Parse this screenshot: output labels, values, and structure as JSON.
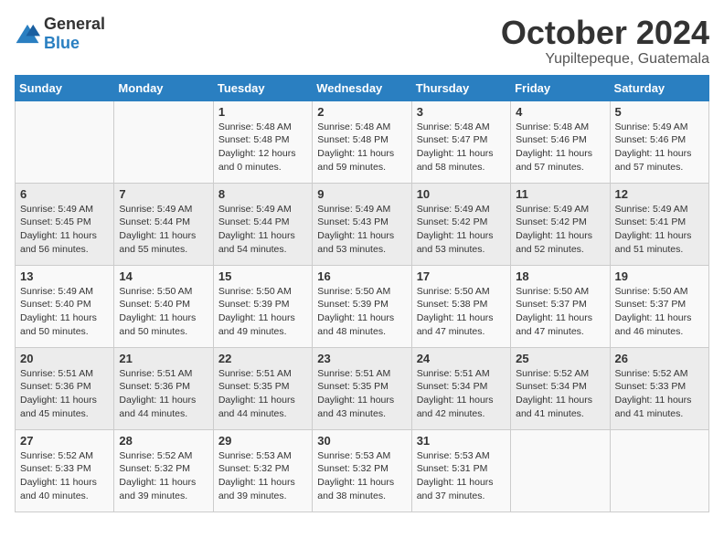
{
  "logo": {
    "general": "General",
    "blue": "Blue"
  },
  "title": "October 2024",
  "subtitle": "Yupiltepeque, Guatemala",
  "headers": [
    "Sunday",
    "Monday",
    "Tuesday",
    "Wednesday",
    "Thursday",
    "Friday",
    "Saturday"
  ],
  "weeks": [
    [
      {
        "day": "",
        "info": ""
      },
      {
        "day": "",
        "info": ""
      },
      {
        "day": "1",
        "info": "Sunrise: 5:48 AM\nSunset: 5:48 PM\nDaylight: 12 hours\nand 0 minutes."
      },
      {
        "day": "2",
        "info": "Sunrise: 5:48 AM\nSunset: 5:48 PM\nDaylight: 11 hours\nand 59 minutes."
      },
      {
        "day": "3",
        "info": "Sunrise: 5:48 AM\nSunset: 5:47 PM\nDaylight: 11 hours\nand 58 minutes."
      },
      {
        "day": "4",
        "info": "Sunrise: 5:48 AM\nSunset: 5:46 PM\nDaylight: 11 hours\nand 57 minutes."
      },
      {
        "day": "5",
        "info": "Sunrise: 5:49 AM\nSunset: 5:46 PM\nDaylight: 11 hours\nand 57 minutes."
      }
    ],
    [
      {
        "day": "6",
        "info": "Sunrise: 5:49 AM\nSunset: 5:45 PM\nDaylight: 11 hours\nand 56 minutes."
      },
      {
        "day": "7",
        "info": "Sunrise: 5:49 AM\nSunset: 5:44 PM\nDaylight: 11 hours\nand 55 minutes."
      },
      {
        "day": "8",
        "info": "Sunrise: 5:49 AM\nSunset: 5:44 PM\nDaylight: 11 hours\nand 54 minutes."
      },
      {
        "day": "9",
        "info": "Sunrise: 5:49 AM\nSunset: 5:43 PM\nDaylight: 11 hours\nand 53 minutes."
      },
      {
        "day": "10",
        "info": "Sunrise: 5:49 AM\nSunset: 5:42 PM\nDaylight: 11 hours\nand 53 minutes."
      },
      {
        "day": "11",
        "info": "Sunrise: 5:49 AM\nSunset: 5:42 PM\nDaylight: 11 hours\nand 52 minutes."
      },
      {
        "day": "12",
        "info": "Sunrise: 5:49 AM\nSunset: 5:41 PM\nDaylight: 11 hours\nand 51 minutes."
      }
    ],
    [
      {
        "day": "13",
        "info": "Sunrise: 5:49 AM\nSunset: 5:40 PM\nDaylight: 11 hours\nand 50 minutes."
      },
      {
        "day": "14",
        "info": "Sunrise: 5:50 AM\nSunset: 5:40 PM\nDaylight: 11 hours\nand 50 minutes."
      },
      {
        "day": "15",
        "info": "Sunrise: 5:50 AM\nSunset: 5:39 PM\nDaylight: 11 hours\nand 49 minutes."
      },
      {
        "day": "16",
        "info": "Sunrise: 5:50 AM\nSunset: 5:39 PM\nDaylight: 11 hours\nand 48 minutes."
      },
      {
        "day": "17",
        "info": "Sunrise: 5:50 AM\nSunset: 5:38 PM\nDaylight: 11 hours\nand 47 minutes."
      },
      {
        "day": "18",
        "info": "Sunrise: 5:50 AM\nSunset: 5:37 PM\nDaylight: 11 hours\nand 47 minutes."
      },
      {
        "day": "19",
        "info": "Sunrise: 5:50 AM\nSunset: 5:37 PM\nDaylight: 11 hours\nand 46 minutes."
      }
    ],
    [
      {
        "day": "20",
        "info": "Sunrise: 5:51 AM\nSunset: 5:36 PM\nDaylight: 11 hours\nand 45 minutes."
      },
      {
        "day": "21",
        "info": "Sunrise: 5:51 AM\nSunset: 5:36 PM\nDaylight: 11 hours\nand 44 minutes."
      },
      {
        "day": "22",
        "info": "Sunrise: 5:51 AM\nSunset: 5:35 PM\nDaylight: 11 hours\nand 44 minutes."
      },
      {
        "day": "23",
        "info": "Sunrise: 5:51 AM\nSunset: 5:35 PM\nDaylight: 11 hours\nand 43 minutes."
      },
      {
        "day": "24",
        "info": "Sunrise: 5:51 AM\nSunset: 5:34 PM\nDaylight: 11 hours\nand 42 minutes."
      },
      {
        "day": "25",
        "info": "Sunrise: 5:52 AM\nSunset: 5:34 PM\nDaylight: 11 hours\nand 41 minutes."
      },
      {
        "day": "26",
        "info": "Sunrise: 5:52 AM\nSunset: 5:33 PM\nDaylight: 11 hours\nand 41 minutes."
      }
    ],
    [
      {
        "day": "27",
        "info": "Sunrise: 5:52 AM\nSunset: 5:33 PM\nDaylight: 11 hours\nand 40 minutes."
      },
      {
        "day": "28",
        "info": "Sunrise: 5:52 AM\nSunset: 5:32 PM\nDaylight: 11 hours\nand 39 minutes."
      },
      {
        "day": "29",
        "info": "Sunrise: 5:53 AM\nSunset: 5:32 PM\nDaylight: 11 hours\nand 39 minutes."
      },
      {
        "day": "30",
        "info": "Sunrise: 5:53 AM\nSunset: 5:32 PM\nDaylight: 11 hours\nand 38 minutes."
      },
      {
        "day": "31",
        "info": "Sunrise: 5:53 AM\nSunset: 5:31 PM\nDaylight: 11 hours\nand 37 minutes."
      },
      {
        "day": "",
        "info": ""
      },
      {
        "day": "",
        "info": ""
      }
    ]
  ]
}
